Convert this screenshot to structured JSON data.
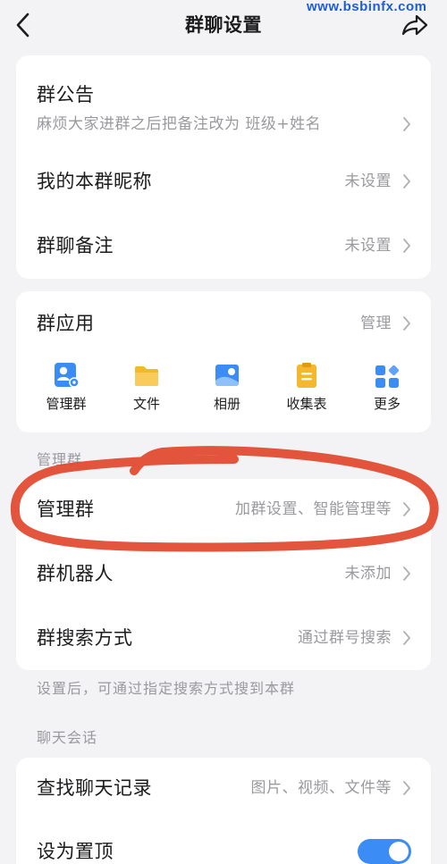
{
  "watermark": "www.bsbinfx.com",
  "header": {
    "title": "群聊设置",
    "back_icon": "back-arrow-icon",
    "share_icon": "share-icon"
  },
  "icons": {
    "row_chevron": "chevron-right-icon"
  },
  "info_card": {
    "rows": [
      {
        "label": "群公告",
        "subtitle": "麻烦大家进群之后把备注改为 班级+姓名"
      },
      {
        "label": "我的本群昵称",
        "value": "未设置"
      },
      {
        "label": "群聊备注",
        "value": "未设置"
      }
    ]
  },
  "apps_card": {
    "label": "群应用",
    "value": "管理",
    "items": [
      {
        "label": "管理群",
        "icon": "manage-group-icon"
      },
      {
        "label": "文件",
        "icon": "folder-icon"
      },
      {
        "label": "相册",
        "icon": "album-icon"
      },
      {
        "label": "收集表",
        "icon": "clipboard-icon"
      },
      {
        "label": "更多",
        "icon": "more-grid-icon"
      }
    ]
  },
  "manage_section": {
    "title": "管理群",
    "rows": [
      {
        "label": "管理群",
        "value": "加群设置、智能管理等"
      },
      {
        "label": "群机器人",
        "value": "未添加"
      },
      {
        "label": "群搜索方式",
        "value": "通过群号搜索"
      }
    ],
    "hint": "设置后，可通过指定搜索方式搜到本群"
  },
  "chat_section": {
    "title": "聊天会话",
    "rows": [
      {
        "label": "查找聊天记录",
        "value": "图片、视频、文件等"
      },
      {
        "label": "设为置顶",
        "toggle_on": true
      }
    ]
  },
  "colors": {
    "background": "#f3f3f5",
    "card": "#ffffff",
    "text_primary": "#1c1c1e",
    "text_secondary": "#9a9a9e",
    "accent_blue": "#3b8cf5",
    "accent_yellow": "#f5b72e",
    "annotation_red": "#e2472c",
    "watermark_blue": "#1d5fd0",
    "chevron": "#b0b0b5",
    "toggle_off": "#dcdce0"
  }
}
